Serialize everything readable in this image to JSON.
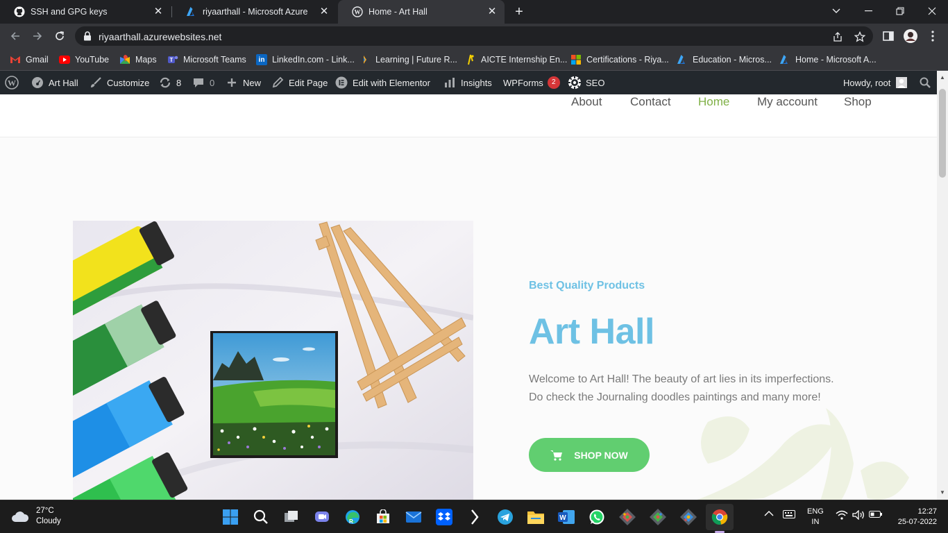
{
  "browser": {
    "tabs": [
      {
        "label": "SSH and GPG keys",
        "icon": "github-icon",
        "active": false
      },
      {
        "label": "riyaarthall - Microsoft Azure",
        "icon": "azure-icon",
        "active": false
      },
      {
        "label": "Home - Art Hall",
        "icon": "wordpress-icon",
        "active": true
      }
    ],
    "new_tab_glyph": "+",
    "url": "riyaarthall.azurewebsites.net",
    "bookmarks": [
      {
        "label": "Gmail",
        "icon": "gmail-icon"
      },
      {
        "label": "YouTube",
        "icon": "youtube-icon"
      },
      {
        "label": "Maps",
        "icon": "maps-icon"
      },
      {
        "label": "Microsoft Teams",
        "icon": "teams-icon"
      },
      {
        "label": "LinkedIn.com - Link...",
        "icon": "linkedin-icon"
      },
      {
        "label": "Learning | Future R...",
        "icon": "future-skills-icon"
      },
      {
        "label": "AICTE Internship En...",
        "icon": "aicte-icon"
      },
      {
        "label": "Certifications - Riya...",
        "icon": "microsoft-icon"
      },
      {
        "label": "Education - Micros...",
        "icon": "azure-icon"
      },
      {
        "label": "Home - Microsoft A...",
        "icon": "azure-icon"
      }
    ]
  },
  "adminbar": {
    "site": "Art Hall",
    "customize": "Customize",
    "updates_count": "8",
    "comments_count": "0",
    "new": "New",
    "edit_page": "Edit Page",
    "elementor": "Edit with Elementor",
    "insights": "Insights",
    "wpforms": "WPForms",
    "wpforms_badge": "2",
    "seo": "SEO",
    "howdy": "Howdy, root"
  },
  "site": {
    "nav": [
      {
        "label": "About",
        "current": false
      },
      {
        "label": "Contact",
        "current": false
      },
      {
        "label": "Home",
        "current": true
      },
      {
        "label": "My account",
        "current": false
      },
      {
        "label": "Shop",
        "current": false
      }
    ],
    "hero": {
      "subtitle": "Best Quality Products",
      "title": "Art Hall",
      "description_line1": "Welcome to Art Hall! The beauty of art lies in its imperfections.",
      "description_line2": "Do check the Journaling doodles paintings and many more!",
      "button": "SHOP NOW"
    },
    "colors": {
      "accent_blue": "#6ec1e4",
      "accent_green": "#61ce70",
      "nav_current": "#7fb046"
    }
  },
  "taskbar": {
    "weather_temp": "27°C",
    "weather_desc": "Cloudy",
    "lang_top": "ENG",
    "lang_bottom": "IN",
    "time": "12:27",
    "date": "25-07-2022"
  }
}
